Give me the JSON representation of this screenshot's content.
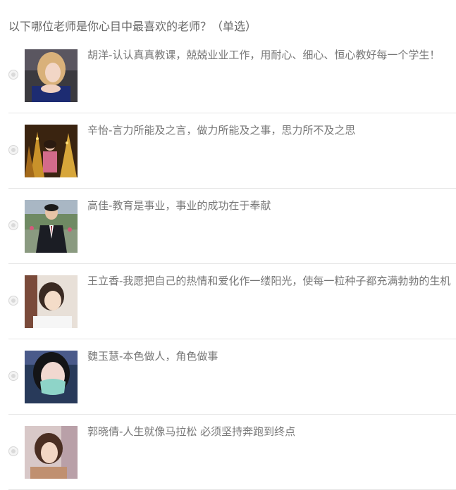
{
  "question": {
    "title": "以下哪位老师是你心目中最喜欢的老师？（单选）",
    "options": [
      {
        "label": "胡洋-认认真真教课，兢兢业业工作，用耐心、细心、恒心教好每一个学生！",
        "photo": "teacher-photo"
      },
      {
        "label": "辛怡-言力所能及之言，做力所能及之事，思力所不及之思",
        "photo": "teacher-photo"
      },
      {
        "label": "高佳-教育是事业，事业的成功在于奉献",
        "photo": "teacher-photo"
      },
      {
        "label": "王立香-我愿把自己的热情和爱化作一缕阳光，使每一粒种子都充满勃勃的生机",
        "photo": "teacher-photo"
      },
      {
        "label": "魏玉慧-本色做人，角色做事",
        "photo": "teacher-photo"
      },
      {
        "label": "郭晓倩-人生就像马拉松 必须坚持奔跑到终点",
        "photo": "teacher-photo"
      }
    ]
  }
}
